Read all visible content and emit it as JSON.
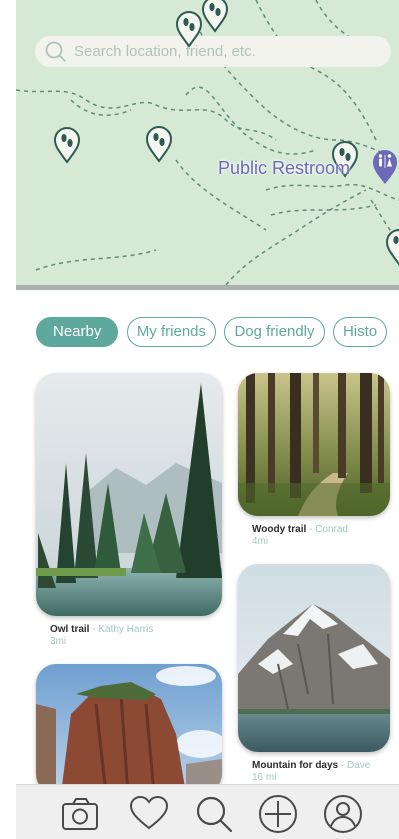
{
  "search": {
    "placeholder": "Search location, friend, etc."
  },
  "map": {
    "poi_label": "Public Restroom",
    "colors": {
      "map_bg": "#d5e9d5",
      "trail": "#5f8c78",
      "pin_fill": "#f4f6f0",
      "pin_stroke": "#2f5b52",
      "poi": "#6c69b8"
    }
  },
  "filters": [
    {
      "label": "Nearby",
      "active": true
    },
    {
      "label": "My friends",
      "active": false
    },
    {
      "label": "Dog friendly",
      "active": false
    },
    {
      "label": "Histo",
      "active": false
    }
  ],
  "cards": [
    {
      "title": "Owl trail",
      "author": "Kathy Harris",
      "distance": "3mi"
    },
    {
      "title": "Woody trail",
      "author": "Conrad",
      "distance": "4mi"
    },
    {
      "title": "",
      "author": "",
      "distance": ""
    },
    {
      "title": "Mountain for days",
      "author": "Dave",
      "distance": "16 mi"
    }
  ],
  "nav": [
    "camera-icon",
    "heart-icon",
    "search-icon",
    "plus-icon",
    "profile-icon"
  ],
  "accent": "#5fa89e"
}
